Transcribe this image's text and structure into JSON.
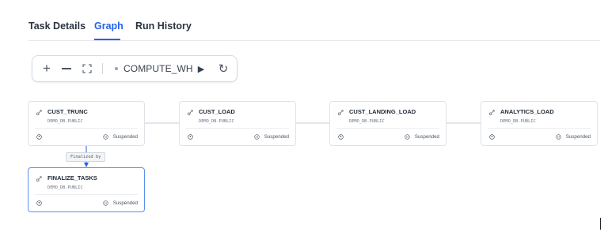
{
  "tabs": [
    {
      "label": "Task Details"
    },
    {
      "label": "Graph"
    },
    {
      "label": "Run History"
    }
  ],
  "active_tab": "Graph",
  "toolbar": {
    "zoom_in_symbol": "+",
    "warehouse": "COMPUTE_WH",
    "play_symbol": "▶",
    "refresh_symbol": "↻"
  },
  "nodes": [
    {
      "name": "CUST_TRUNC",
      "schema": "DEMO_DB.PUBLIC",
      "status": "Suspended"
    },
    {
      "name": "CUST_LOAD",
      "schema": "DEMO_DB.PUBLIC",
      "status": "Suspended"
    },
    {
      "name": "CUST_LANDING_LOAD",
      "schema": "DEMO_DB.PUBLIC",
      "status": "Suspended"
    },
    {
      "name": "ANALYTICS_LOAD",
      "schema": "DEMO_DB.PUBLIC",
      "status": "Suspended"
    },
    {
      "name": "FINALIZE_TASKS",
      "schema": "DEMO_DB.PUBLIC",
      "status": "Suspended",
      "selected": true
    }
  ],
  "edge_label": "Finalized by",
  "colors": {
    "accent": "#2563eb",
    "edge": "#c9ced6",
    "selected_border": "#5b8ff3"
  }
}
